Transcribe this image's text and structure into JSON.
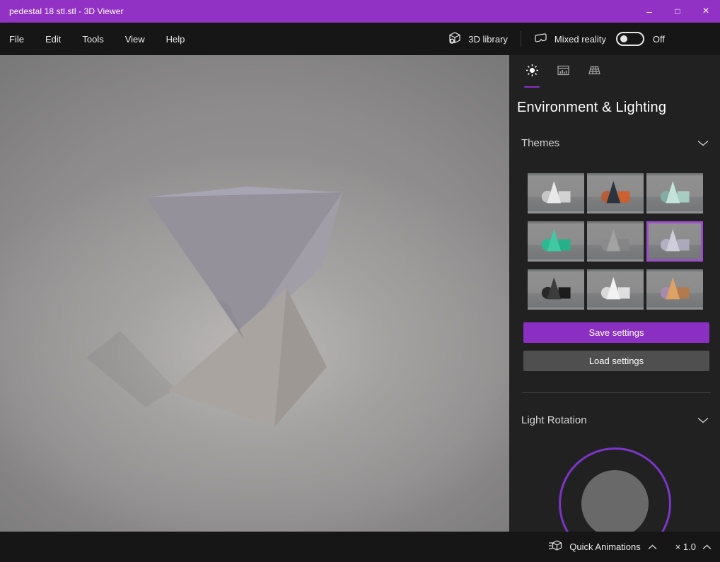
{
  "window": {
    "title": "pedestal 18 stl.stl - 3D Viewer",
    "minimize": "–",
    "maximize": "□",
    "close": "×"
  },
  "menubar": {
    "items": {
      "file": "File",
      "edit": "Edit",
      "tools": "Tools",
      "view": "View",
      "help": "Help"
    },
    "library": "3D library",
    "mixed_reality": "Mixed reality",
    "mixed_reality_state": "Off"
  },
  "panel": {
    "title": "Environment & Lighting",
    "tabs": [
      {
        "name": "environment-lighting",
        "icon": "sun-icon",
        "active": true
      },
      {
        "name": "stats",
        "icon": "stats-icon",
        "active": false
      },
      {
        "name": "grid",
        "icon": "grid-icon",
        "active": false
      }
    ],
    "themes": {
      "label": "Themes",
      "tiles": [
        {
          "selected": false,
          "sphere": "#c9c9c9",
          "cone": "#e8e8e8",
          "cube": "#d6d6d6"
        },
        {
          "selected": false,
          "sphere": "#b85c33",
          "cone": "#2c3440",
          "cube": "#cf5f2b"
        },
        {
          "selected": false,
          "sphere": "#84b0a5",
          "cone": "#c5e3db",
          "cube": "#a9d0c5"
        },
        {
          "selected": false,
          "sphere": "#27bd92",
          "cone": "#3fcaa4",
          "cube": "#22b38a"
        },
        {
          "selected": false,
          "sphere": "#8b8b8b",
          "cone": "#a2a2a2",
          "cube": "#858585"
        },
        {
          "selected": true,
          "sphere": "#b6b2c6",
          "cone": "#cfccdc",
          "cube": "#aeabbe"
        },
        {
          "selected": false,
          "sphere": "#232323",
          "cone": "#3c3c3c",
          "cube": "#161616"
        },
        {
          "selected": false,
          "sphere": "#dedede",
          "cone": "#f2f2f2",
          "cube": "#e4e4e4"
        },
        {
          "selected": false,
          "sphere": "#a98bb0",
          "cone": "#dba264",
          "cube": "#b57a4a"
        }
      ]
    },
    "save_button": "Save settings",
    "load_button": "Load settings",
    "light_rotation_label": "Light Rotation"
  },
  "bottombar": {
    "quick_animations": "Quick Animations",
    "speed": "× 1.0"
  },
  "colors": {
    "titlebar": "#9232c4",
    "accent": "#8a2fc2",
    "selected_tile_border": "#9b4dca",
    "dial_ring": "#7b35c9"
  }
}
